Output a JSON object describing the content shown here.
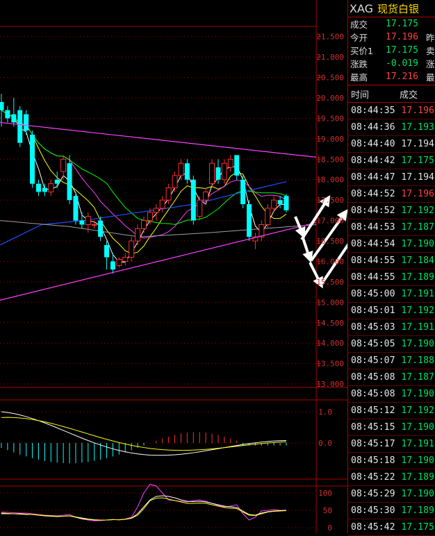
{
  "header": {
    "symbol": "XAG",
    "name": "现货白银"
  },
  "quotes": [
    {
      "label": "成交",
      "value": "17.175",
      "cls": "dn",
      "extra": ""
    },
    {
      "label": "今开",
      "value": "17.196",
      "cls": "up",
      "extra": "昨"
    },
    {
      "label": "买价1",
      "value": "17.175",
      "cls": "dn",
      "extra": "卖"
    },
    {
      "label": "涨跌",
      "value": "-0.019",
      "cls": "dn",
      "extra": "涨"
    },
    {
      "label": "最高",
      "value": "17.216",
      "cls": "up",
      "extra": "最"
    }
  ],
  "ticks_header": {
    "time": "时间",
    "price": "成交"
  },
  "ticks": [
    {
      "time": "08:44:35",
      "price": "17.196",
      "cls": "up"
    },
    {
      "time": "08:44:36",
      "price": "17.193",
      "cls": "dn"
    },
    {
      "time": "08:44:40",
      "price": "17.194",
      "cls": "eq"
    },
    {
      "time": "08:44:42",
      "price": "17.175",
      "cls": "dn"
    },
    {
      "time": "08:44:47",
      "price": "17.194",
      "cls": "eq"
    },
    {
      "time": "08:44:52",
      "price": "17.196",
      "cls": "up"
    },
    {
      "time": "08:44:52",
      "price": "17.192",
      "cls": "dn"
    },
    {
      "time": "08:44:53",
      "price": "17.187",
      "cls": "dn"
    },
    {
      "time": "08:44:54",
      "price": "17.190",
      "cls": "dn"
    },
    {
      "time": "08:44:55",
      "price": "17.184",
      "cls": "dn"
    },
    {
      "time": "08:44:55",
      "price": "17.189",
      "cls": "dn"
    },
    {
      "time": "08:45:00",
      "price": "17.191",
      "cls": "dn"
    },
    {
      "time": "08:45:01",
      "price": "17.192",
      "cls": "dn"
    },
    {
      "time": "08:45:03",
      "price": "17.191",
      "cls": "dn"
    },
    {
      "time": "08:45:05",
      "price": "17.190",
      "cls": "dn"
    },
    {
      "time": "08:45:07",
      "price": "17.188",
      "cls": "dn"
    },
    {
      "time": "08:45:08",
      "price": "17.187",
      "cls": "dn"
    },
    {
      "time": "08:45:08",
      "price": "17.190",
      "cls": "dn"
    },
    {
      "time": "08:45:12",
      "price": "17.192",
      "cls": "dn"
    },
    {
      "time": "08:45:15",
      "price": "17.190",
      "cls": "dn"
    },
    {
      "time": "08:45:17",
      "price": "17.191",
      "cls": "dn"
    },
    {
      "time": "08:45:18",
      "price": "17.190",
      "cls": "dn"
    },
    {
      "time": "08:45:22",
      "price": "17.189",
      "cls": "dn"
    },
    {
      "time": "08:45:29",
      "price": "17.190",
      "cls": "dn"
    },
    {
      "time": "08:45:30",
      "price": "17.189",
      "cls": "dn"
    },
    {
      "time": "08:45:42",
      "price": "17.175",
      "cls": "dn"
    }
  ],
  "chart_data": {
    "type": "candlestick",
    "price_axis": [
      "21.500",
      "21.000",
      "20.500",
      "20.000",
      "19.500",
      "19.000",
      "18.500",
      "18.000",
      "17.500",
      "17.000",
      "16.500",
      "16.000",
      "15.500",
      "15.000",
      "14.500",
      "14.000",
      "13.500",
      "13.000"
    ],
    "price_range": [
      13.0,
      21.5
    ],
    "macd_axis": [
      "1.0",
      "0.0"
    ],
    "kdj_axis": [
      "100",
      "50",
      "0"
    ],
    "colors": {
      "up": "#ff3030",
      "down": "#00ffff",
      "grid": "#b00000",
      "ma5": "#ffffff",
      "ma10": "#ffff00",
      "ma20": "#ff40ff",
      "ma30": "#00ff00",
      "ma60": "#2050ff",
      "ma120": "#a0a0a0",
      "trend": "#ff40ff"
    },
    "candles": [
      {
        "o": 19.9,
        "h": 20.1,
        "l": 19.3,
        "c": 19.7
      },
      {
        "o": 19.7,
        "h": 19.8,
        "l": 19.4,
        "c": 19.5
      },
      {
        "o": 19.6,
        "h": 20.0,
        "l": 19.3,
        "c": 19.4
      },
      {
        "o": 19.7,
        "h": 19.8,
        "l": 18.8,
        "c": 18.9
      },
      {
        "o": 19.6,
        "h": 19.7,
        "l": 19.1,
        "c": 19.2
      },
      {
        "o": 19.1,
        "h": 19.2,
        "l": 17.8,
        "c": 17.9
      },
      {
        "o": 17.9,
        "h": 18.0,
        "l": 17.6,
        "c": 17.7
      },
      {
        "o": 17.8,
        "h": 17.9,
        "l": 17.6,
        "c": 17.7
      },
      {
        "o": 17.7,
        "h": 18.0,
        "l": 17.6,
        "c": 17.9
      },
      {
        "o": 18.0,
        "h": 18.2,
        "l": 17.8,
        "c": 17.9
      },
      {
        "o": 18.2,
        "h": 18.6,
        "l": 18.0,
        "c": 18.5
      },
      {
        "o": 18.4,
        "h": 18.6,
        "l": 17.4,
        "c": 17.5
      },
      {
        "o": 17.6,
        "h": 17.7,
        "l": 16.9,
        "c": 17.0
      },
      {
        "o": 17.0,
        "h": 17.2,
        "l": 16.8,
        "c": 16.9
      },
      {
        "o": 16.9,
        "h": 17.2,
        "l": 16.7,
        "c": 17.1
      },
      {
        "o": 16.9,
        "h": 17.0,
        "l": 16.8,
        "c": 16.9
      },
      {
        "o": 17.0,
        "h": 17.1,
        "l": 16.5,
        "c": 16.6
      },
      {
        "o": 16.4,
        "h": 16.5,
        "l": 15.8,
        "c": 16.1
      },
      {
        "o": 16.0,
        "h": 16.2,
        "l": 15.7,
        "c": 15.8
      },
      {
        "o": 15.9,
        "h": 16.1,
        "l": 15.85,
        "c": 16.05
      },
      {
        "o": 16.0,
        "h": 16.2,
        "l": 15.9,
        "c": 16.1
      },
      {
        "o": 16.1,
        "h": 16.6,
        "l": 16.0,
        "c": 16.5
      },
      {
        "o": 16.5,
        "h": 16.9,
        "l": 16.4,
        "c": 16.8
      },
      {
        "o": 16.8,
        "h": 17.1,
        "l": 16.7,
        "c": 17.0
      },
      {
        "o": 17.0,
        "h": 17.3,
        "l": 16.9,
        "c": 17.2
      },
      {
        "o": 17.2,
        "h": 17.4,
        "l": 17.0,
        "c": 17.3
      },
      {
        "o": 17.3,
        "h": 17.6,
        "l": 17.2,
        "c": 17.5
      },
      {
        "o": 17.5,
        "h": 17.9,
        "l": 17.4,
        "c": 17.8
      },
      {
        "o": 17.8,
        "h": 18.2,
        "l": 17.7,
        "c": 18.1
      },
      {
        "o": 18.1,
        "h": 18.5,
        "l": 18.0,
        "c": 18.4
      },
      {
        "o": 18.4,
        "h": 18.5,
        "l": 17.9,
        "c": 18.0
      },
      {
        "o": 18.0,
        "h": 18.1,
        "l": 16.9,
        "c": 17.0
      },
      {
        "o": 17.1,
        "h": 17.6,
        "l": 17.0,
        "c": 17.5
      },
      {
        "o": 17.5,
        "h": 17.8,
        "l": 17.4,
        "c": 17.7
      },
      {
        "o": 17.9,
        "h": 18.5,
        "l": 17.8,
        "c": 18.4
      },
      {
        "o": 18.3,
        "h": 18.5,
        "l": 17.9,
        "c": 18.0
      },
      {
        "o": 18.0,
        "h": 18.5,
        "l": 17.9,
        "c": 18.4
      },
      {
        "o": 18.3,
        "h": 18.6,
        "l": 18.2,
        "c": 18.5
      },
      {
        "o": 18.6,
        "h": 18.6,
        "l": 18.0,
        "c": 18.1
      },
      {
        "o": 18.0,
        "h": 18.1,
        "l": 17.3,
        "c": 17.4
      },
      {
        "o": 17.4,
        "h": 17.5,
        "l": 16.5,
        "c": 16.6
      },
      {
        "o": 16.5,
        "h": 16.7,
        "l": 16.3,
        "c": 16.6
      },
      {
        "o": 16.6,
        "h": 17.0,
        "l": 16.5,
        "c": 16.9
      },
      {
        "o": 16.9,
        "h": 17.4,
        "l": 16.8,
        "c": 17.3
      },
      {
        "o": 17.3,
        "h": 17.6,
        "l": 17.2,
        "c": 17.5
      },
      {
        "o": 17.5,
        "h": 17.6,
        "l": 17.3,
        "c": 17.4
      },
      {
        "o": 17.6,
        "h": 17.65,
        "l": 17.2,
        "c": 17.25
      }
    ]
  }
}
